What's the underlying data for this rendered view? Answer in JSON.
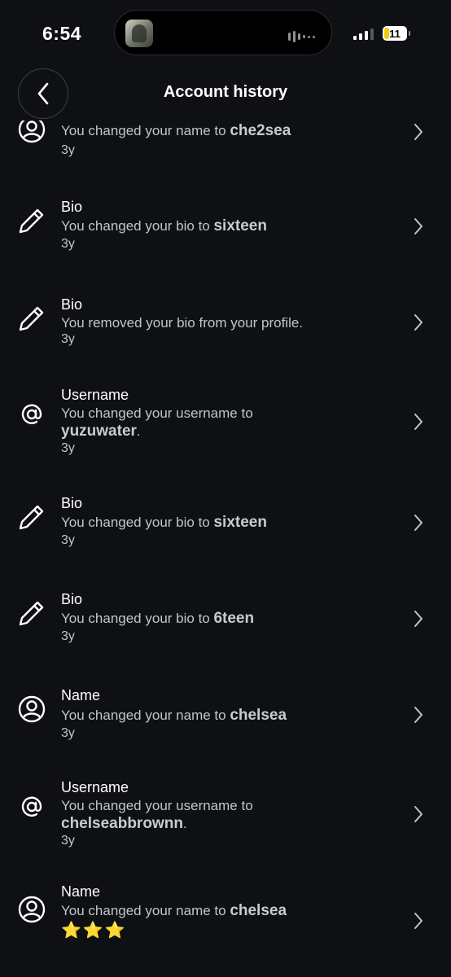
{
  "status_bar": {
    "time": "6:54",
    "battery": "11"
  },
  "header": {
    "title": "Account history"
  },
  "items": [
    {
      "icon": "user-circle-icon",
      "title": "",
      "desc_prefix": "You changed your name to ",
      "desc_value": "che2sea",
      "desc_suffix": "",
      "time": "3y"
    },
    {
      "icon": "pencil-icon",
      "title": "Bio",
      "desc_prefix": "You changed your bio to ",
      "desc_value": "sixteen",
      "desc_suffix": "",
      "time": "3y"
    },
    {
      "icon": "pencil-icon",
      "title": "Bio",
      "desc_prefix": "You removed your bio from your profile.",
      "desc_value": "",
      "desc_suffix": "",
      "time": "3y"
    },
    {
      "icon": "at-sign-icon",
      "title": "Username",
      "desc_prefix": "You changed your username to ",
      "desc_value": "yuzuwater",
      "desc_suffix": ".",
      "time": "3y"
    },
    {
      "icon": "pencil-icon",
      "title": "Bio",
      "desc_prefix": "You changed your bio to ",
      "desc_value": "sixteen",
      "desc_suffix": "",
      "time": "3y"
    },
    {
      "icon": "pencil-icon",
      "title": "Bio",
      "desc_prefix": "You changed your bio to ",
      "desc_value": "6teen",
      "desc_suffix": "",
      "time": "3y"
    },
    {
      "icon": "user-circle-icon",
      "title": "Name",
      "desc_prefix": "You changed your name to ",
      "desc_value": "chelsea",
      "desc_suffix": "",
      "time": "3y"
    },
    {
      "icon": "at-sign-icon",
      "title": "Username",
      "desc_prefix": "You changed your username to ",
      "desc_value": "chelseabbrownn",
      "desc_suffix": ".",
      "time": "3y"
    },
    {
      "icon": "user-circle-icon",
      "title": "Name",
      "desc_prefix": "You changed your name to ",
      "desc_value": "chelsea",
      "desc_suffix": "",
      "stars": "⭐⭐⭐",
      "time": ""
    }
  ]
}
